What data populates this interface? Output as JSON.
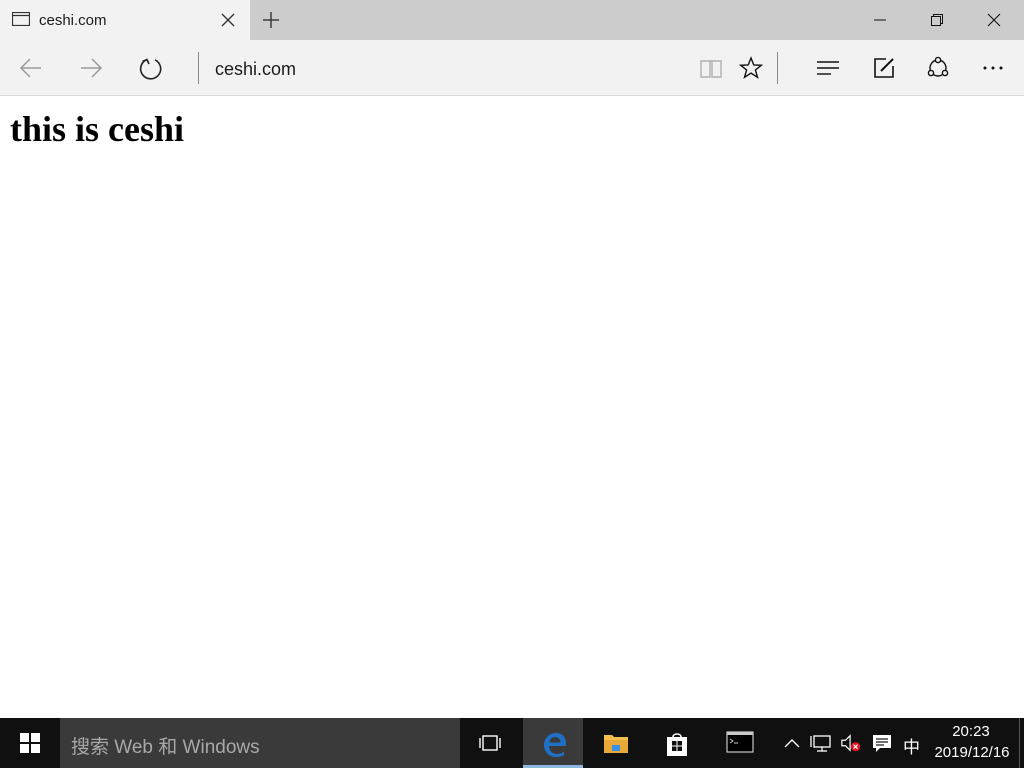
{
  "browser": {
    "tab": {
      "title": "ceshi.com",
      "icon": "page-icon"
    },
    "address": "ceshi.com"
  },
  "page": {
    "heading": "this is ceshi"
  },
  "taskbar": {
    "search_placeholder": "搜索 Web 和 Windows",
    "ime": "中",
    "time": "20:23",
    "date": "2019/12/16",
    "apps": [
      "task-view-icon",
      "edge-icon",
      "file-explorer-icon",
      "store-icon",
      "command-prompt-icon"
    ]
  },
  "colors": {
    "titlebar": "#cccccc",
    "toolbar": "#f2f2f2",
    "taskbar": "#101010",
    "search": "#3a3a3a",
    "edge_blue": "#1f6fc5",
    "folder_yellow": "#f6c14a"
  }
}
